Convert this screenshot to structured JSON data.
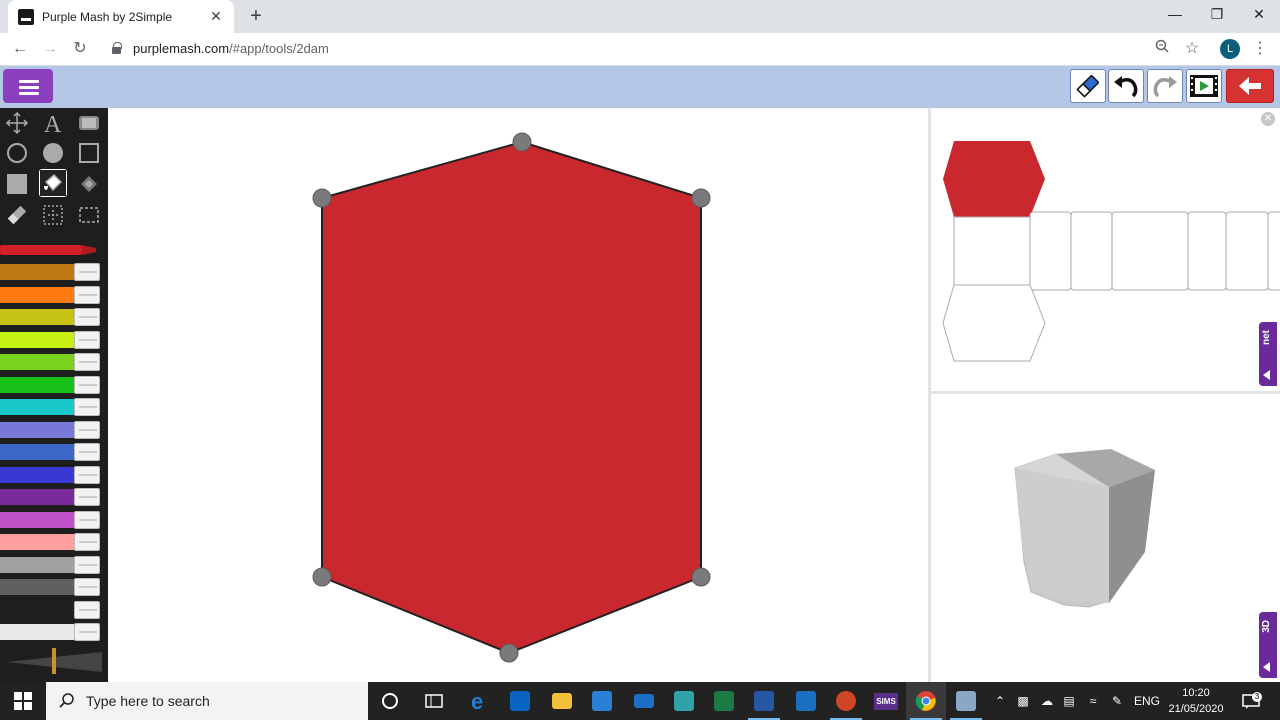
{
  "browser": {
    "tab_title": "Purple Mash by 2Simple",
    "tab_close": "✕",
    "new_tab": "+",
    "url_host": "purplemash.com",
    "url_path": "/#app/tools/2dam",
    "profile_initial": "L",
    "window_controls": {
      "minimize": "—",
      "restore": "❐",
      "close": "✕"
    }
  },
  "app": {
    "toolbar": {
      "clear_icon": "eraser-icon",
      "undo_icon": "undo-icon",
      "redo_icon": "redo-icon",
      "play_icon": "play-film-icon",
      "back_icon": "back-arrow-icon",
      "colors": {
        "toolbar_bg": "#b4c7e7",
        "menu_bg": "#8a3fbf",
        "back_bg": "#d73232"
      }
    },
    "tools": [
      "move-icon",
      "text-icon",
      "stamp-icon",
      "circle-outline-icon",
      "circle-filled-icon",
      "square-outline-icon",
      "square-filled-icon",
      "fill-bucket-icon",
      "pattern-fill-icon",
      "eraser-tool-icon",
      "select-icon",
      "marquee-icon"
    ],
    "palette": {
      "selected": "#d32027",
      "pens": [
        "#c07a14",
        "#ff7a10",
        "#c6c214",
        "#c6f014",
        "#7ad21e",
        "#18c018",
        "#18c8c8",
        "#7878d6",
        "#3c66c8",
        "#3838d2",
        "#7a2a9a",
        "#c050c8",
        "#ffa0a0",
        "#a0a0a0",
        "#606060",
        "#202020",
        "#e8e8e8"
      ]
    },
    "shape": {
      "fill": "#c8282e",
      "stroke": "#222222",
      "handle": "#7a7a7a"
    },
    "net_tab_label": "net",
    "d3_tab_label": "3D",
    "close_label": "✕"
  },
  "taskbar": {
    "search_placeholder": "Type here to search",
    "apps": [
      "cortana-icon",
      "task-view-icon",
      "edge-icon",
      "outlook-icon",
      "file-explorer-icon",
      "store-icon",
      "mail-icon",
      "sway-icon",
      "excel-icon",
      "word-icon",
      "remote-icon",
      "powerpoint-icon",
      "sims-icon",
      "chrome-icon",
      "server-icon"
    ],
    "sims_label": "SIMS",
    "language": "ENG",
    "time": "10:20",
    "date": "21/05/2020",
    "notifications": "3"
  }
}
